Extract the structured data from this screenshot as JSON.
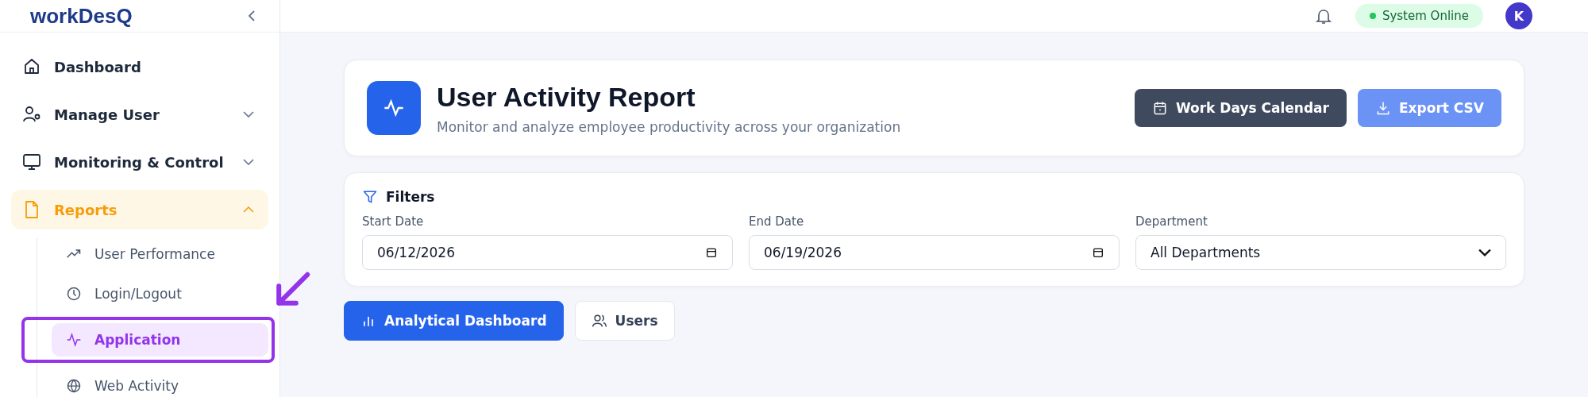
{
  "sidebar": {
    "logo": "workDesQ",
    "items": [
      {
        "label": "Dashboard",
        "kind": "link",
        "selected": false
      },
      {
        "label": "Manage User",
        "kind": "group",
        "expanded": false,
        "selected": false
      },
      {
        "label": "Monitoring & Control",
        "kind": "group",
        "expanded": false,
        "selected": false
      },
      {
        "label": "Reports",
        "kind": "group",
        "expanded": true,
        "selected": true,
        "children": [
          {
            "label": "User Performance",
            "selected": false
          },
          {
            "label": "Login/Logout",
            "selected": false
          },
          {
            "label": "Application",
            "selected": true
          },
          {
            "label": "Web Activity",
            "selected": false
          }
        ]
      }
    ]
  },
  "topbar": {
    "status": "System Online",
    "avatar": "K"
  },
  "header": {
    "title": "User Activity Report",
    "subtitle": "Monitor and analyze employee productivity across your organization",
    "buttons": [
      {
        "label": "Work Days Calendar",
        "kind": "calendar"
      },
      {
        "label": "Export CSV",
        "kind": "export"
      }
    ]
  },
  "filters": {
    "title": "Filters",
    "fields": [
      {
        "label": "Start Date",
        "value": "06/12/2026",
        "kind": "date"
      },
      {
        "label": "End Date",
        "value": "06/19/2026",
        "kind": "date"
      },
      {
        "label": "Department",
        "value": "All Departments",
        "kind": "select"
      }
    ]
  },
  "tabs": [
    {
      "label": "Analytical Dashboard",
      "selected": true
    },
    {
      "label": "Users",
      "selected": false
    }
  ]
}
